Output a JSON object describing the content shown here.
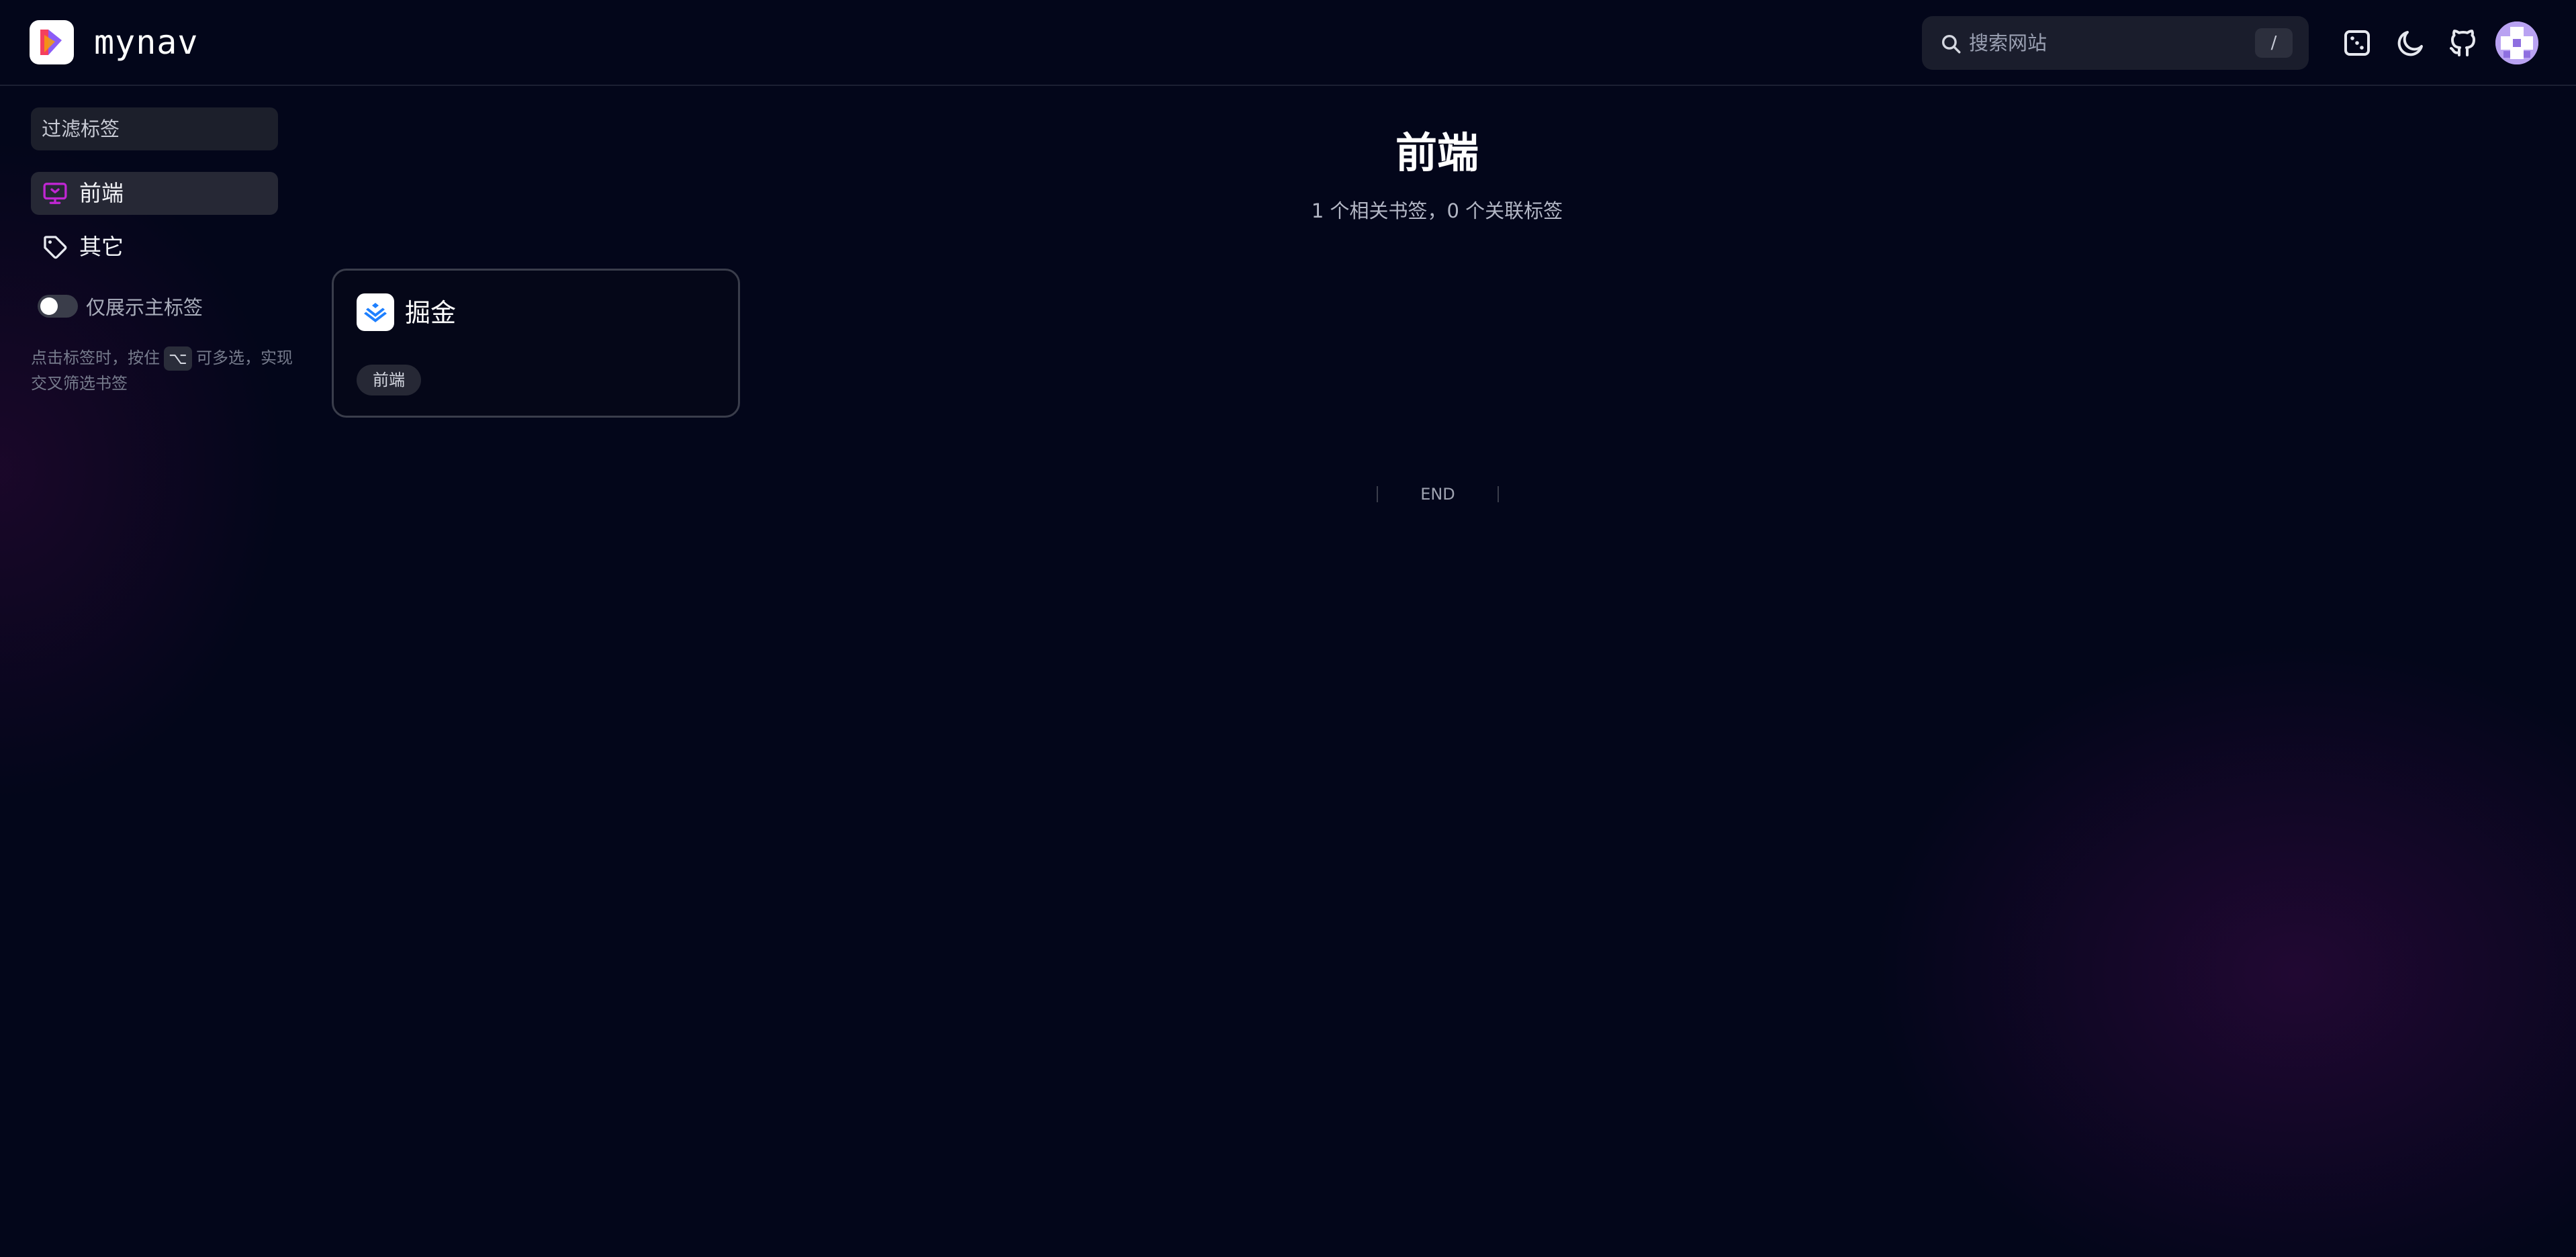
{
  "header": {
    "app_name": "mynav",
    "search": {
      "placeholder": "搜索网站",
      "shortcut": "/"
    },
    "icons": [
      "dice-icon",
      "moon-icon",
      "github-icon",
      "avatar"
    ]
  },
  "sidebar": {
    "filter_placeholder": "过滤标签",
    "items": [
      {
        "label": "前端",
        "icon": "monitor-icon",
        "active": true
      },
      {
        "label": "其它",
        "icon": "tag-icon",
        "active": false
      }
    ],
    "toggle_label": "仅展示主标签",
    "hint_before": "点击标签时，按住",
    "hint_key": "⌥",
    "hint_after": "可多选，实现交叉筛选书签"
  },
  "main": {
    "title": "前端",
    "subtitle": "1 个相关书签，0 个关联标签",
    "cards": [
      {
        "title": "掘金",
        "tag": "前端"
      }
    ],
    "end_text": "END"
  },
  "colors": {
    "background": "#03061a",
    "accent_purple": "#c026d3",
    "card_border": "#3a3d4b"
  }
}
